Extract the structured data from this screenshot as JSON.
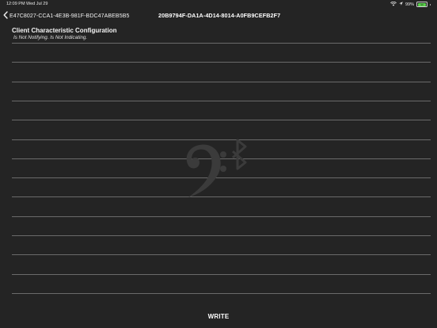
{
  "status_bar": {
    "time": "12:09 PM",
    "date": "Wed Jul 29",
    "battery_pct": "99%",
    "battery_level": 0.99,
    "battery_text": "99"
  },
  "nav": {
    "back_label": "E47C8027-CCA1-4E3B-981F-BDC47ABEB5B5",
    "title": "20B9794F-DA1A-4D14-8014-A0FB9CEFB2F7"
  },
  "descriptor": {
    "title": "Client Characteristic Configuration",
    "status": "Is Not Notifying. Is Not Indicating."
  },
  "actions": {
    "write_label": "WRITE"
  },
  "colors": {
    "background": "#242424",
    "rule": "#6a6a6a",
    "watermark": "#3a3a3a",
    "battery": "#5ad14c"
  },
  "icons": {
    "back": "chevron-left-icon",
    "wifi": "wifi-icon",
    "location": "location-arrow-icon",
    "battery": "battery-icon",
    "watermark": "bass-clef-bluetooth-logo"
  }
}
